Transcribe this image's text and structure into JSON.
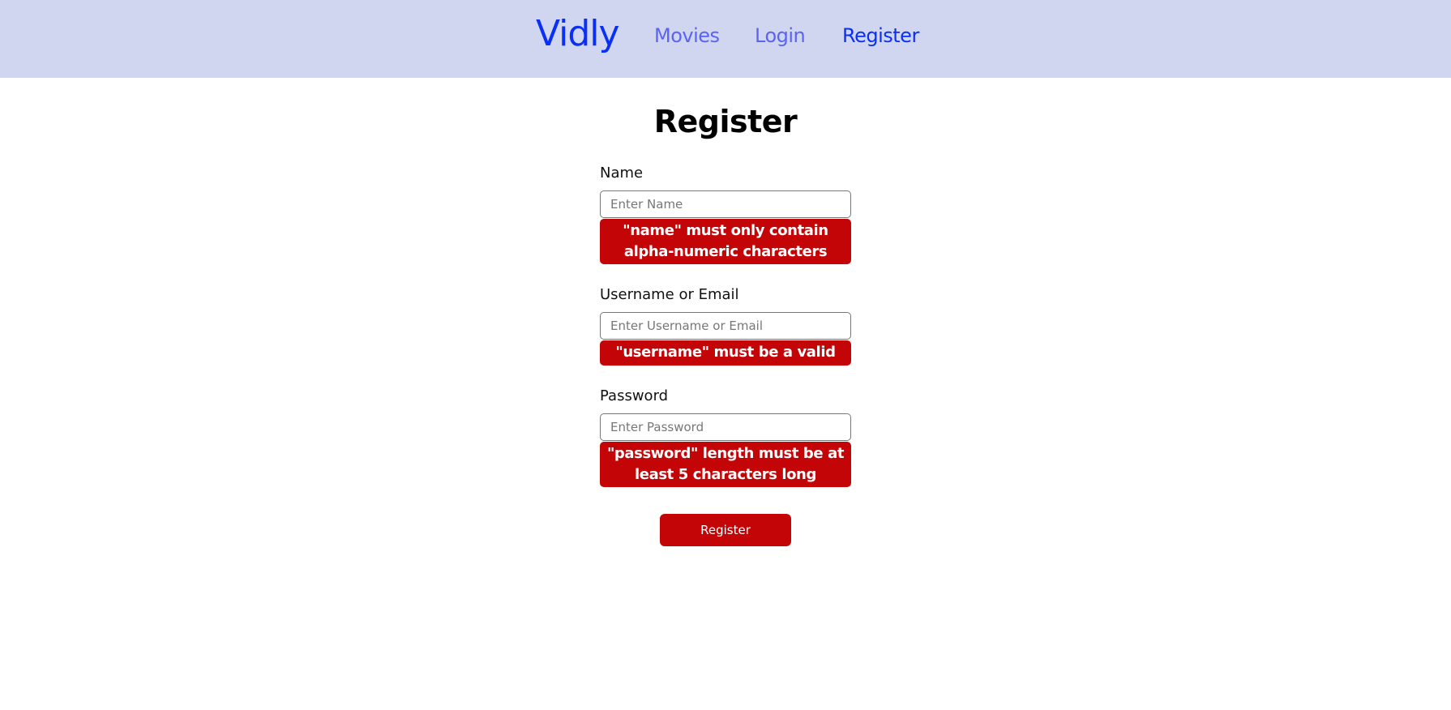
{
  "nav": {
    "brand": "Vidly",
    "links": [
      "Movies",
      "Login",
      "Register"
    ]
  },
  "page": {
    "title": "Register"
  },
  "form": {
    "name": {
      "label": "Name",
      "placeholder": "Enter Name",
      "error": "\"name\" must only contain alpha-numeric characters"
    },
    "username": {
      "label": "Username or Email",
      "placeholder": "Enter Username or Email",
      "error": "\"username\" must be a valid email"
    },
    "password": {
      "label": "Password",
      "placeholder": "Enter Password",
      "error": "\"password\" length must be at least 5 characters long"
    },
    "submit": "Register"
  }
}
